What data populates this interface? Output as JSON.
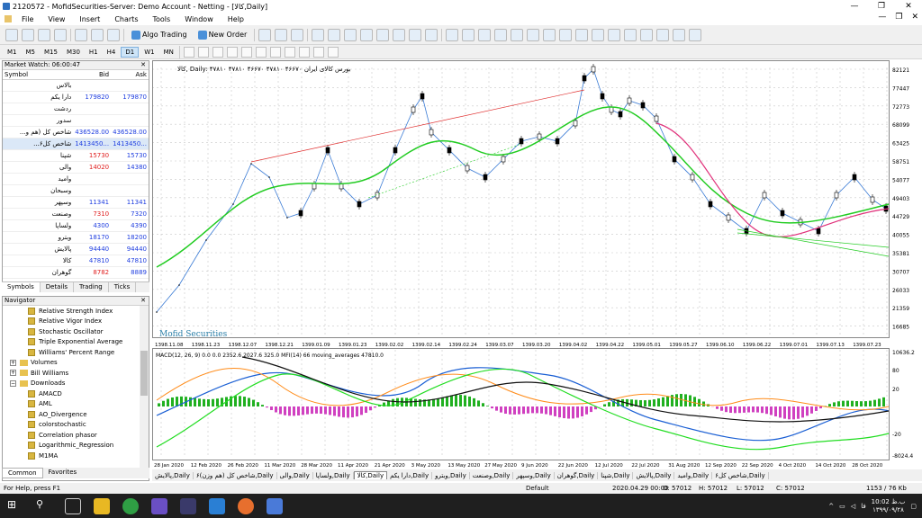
{
  "window": {
    "title": "2120572 - MofidSecurities-Server: Demo Account - Netting - [کالا,Daily]"
  },
  "menu": [
    "File",
    "View",
    "Insert",
    "Charts",
    "Tools",
    "Window",
    "Help"
  ],
  "toolbar": {
    "algo_label": "Algo Trading",
    "neworder_label": "New Order"
  },
  "timeframes": [
    "M1",
    "M5",
    "M15",
    "M30",
    "H1",
    "H4",
    "D1",
    "W1",
    "MN"
  ],
  "active_timeframe": "D1",
  "market_watch": {
    "title": "Market Watch: 06:00:47",
    "headers": {
      "symbol": "Symbol",
      "bid": "Bid",
      "ask": "Ask"
    },
    "rows": [
      {
        "symbol": "بالاس",
        "bid": "",
        "ask": ""
      },
      {
        "symbol": "دارا يکم",
        "bid": "179820",
        "ask": "179870"
      },
      {
        "symbol": "ردشت",
        "bid": "",
        "ask": ""
      },
      {
        "symbol": "سدور",
        "bid": "",
        "ask": ""
      },
      {
        "symbol": "شاخص کل (هم و...",
        "bid": "436528.00",
        "ask": "436528.00"
      },
      {
        "symbol": "شاخص کل۶...",
        "bid": "1413450...",
        "ask": "1413450..."
      },
      {
        "symbol": "شپنا",
        "bid": "15730",
        "ask": "15730"
      },
      {
        "symbol": "والی",
        "bid": "14020",
        "ask": "14380"
      },
      {
        "symbol": "واميد",
        "bid": "",
        "ask": ""
      },
      {
        "symbol": "وسبحان",
        "bid": "",
        "ask": ""
      },
      {
        "symbol": "وسپهر",
        "bid": "11341",
        "ask": "11341"
      },
      {
        "symbol": "وصنعت",
        "bid": "7310",
        "ask": "7320"
      },
      {
        "symbol": "ولساپا",
        "bid": "4300",
        "ask": "4390"
      },
      {
        "symbol": "وبترو",
        "bid": "18170",
        "ask": "18200"
      },
      {
        "symbol": "پالايش",
        "bid": "94440",
        "ask": "94440"
      },
      {
        "symbol": "کالا",
        "bid": "47810",
        "ask": "47810"
      },
      {
        "symbol": "گوهران",
        "bid": "8782",
        "ask": "8889"
      }
    ],
    "tabs": [
      "Symbols",
      "Details",
      "Trading",
      "Ticks"
    ]
  },
  "navigator": {
    "title": "Navigator",
    "items": [
      {
        "label": "Relative Strength Index",
        "type": "ind"
      },
      {
        "label": "Relative Vigor Index",
        "type": "ind"
      },
      {
        "label": "Stochastic Oscillator",
        "type": "ind"
      },
      {
        "label": "Triple Exponential Average",
        "type": "ind"
      },
      {
        "label": "Williams' Percent Range",
        "type": "ind"
      },
      {
        "label": "Volumes",
        "type": "folder"
      },
      {
        "label": "Bill Williams",
        "type": "folder"
      },
      {
        "label": "Downloads",
        "type": "open"
      },
      {
        "label": "AMACD",
        "type": "ind"
      },
      {
        "label": "AML",
        "type": "ind"
      },
      {
        "label": "AO_Divergence",
        "type": "ind"
      },
      {
        "label": "colorstochastic",
        "type": "ind"
      },
      {
        "label": "Correlation phasor",
        "type": "ind"
      },
      {
        "label": "Logarithmic_Regression",
        "type": "ind"
      },
      {
        "label": "M1MA",
        "type": "ind"
      }
    ],
    "tabs": [
      "Common",
      "Favorites"
    ]
  },
  "chart": {
    "header": "کالا, Daily: ۴۷۸۱۰ ۴۷۸۱۰ ۴۶۶۷۰ ۴۷۸۱۰ ۴۶۶۷۰  بورس کالای ایران",
    "watermark": "Mofid Securities",
    "price_ticks": [
      "82121",
      "77447",
      "72773",
      "68099",
      "63425",
      "58751",
      "54077",
      "49403",
      "44729",
      "40055",
      "35381",
      "30707",
      "26033",
      "21359",
      "16685"
    ],
    "jalali_dates": [
      "1398.11.08",
      "1398.11.23",
      "1398.12.07",
      "1398.12.21",
      "1399.01.09",
      "1399.01.23",
      "1399.02.02",
      "1399.02.14",
      "1399.02.24",
      "1399.03.07",
      "1399.03.20",
      "1399.04.02",
      "1399.04.22",
      "1399.05.01",
      "1399.05.27",
      "1399.06.10",
      "1399.06.22",
      "1399.07.01",
      "1399.07.13",
      "1399.07.23"
    ],
    "macd_label": "MACD(12, 26, 9) 0.0 0.0 2352.6 2027.6 325.0 MFI(14) 66 moving_averages 47810.0",
    "macd_ticks": [
      "10636.2",
      "80",
      "20",
      "-20",
      "-8024.4"
    ],
    "greg_dates": [
      "28 Jan 2020",
      "12 Feb 2020",
      "26 Feb 2020",
      "11 Mar 2020",
      "28 Mar 2020",
      "11 Apr 2020",
      "21 Apr 2020",
      "3 May 2020",
      "13 May 2020",
      "27 May 2020",
      "9 Jun 2020",
      "22 Jun 2020",
      "12 Jul 2020",
      "22 Jul 2020",
      "31 Aug 2020",
      "12 Sep 2020",
      "22 Sep 2020",
      "4 Oct 2020",
      "14 Oct 2020",
      "28 Oct 2020"
    ]
  },
  "chart_tabs": [
    "پالايش,Daily",
    "شاخص کل (هم وزن)۶,Daily",
    "والی,Daily",
    "ولساپا,Daily",
    "کالا,Daily",
    "دارا يکم,Daily",
    "وبترو,Daily",
    "وصنعت,Daily",
    "وسپهر,Daily",
    "گوهران,Daily",
    "شپنا,Daily",
    "پالايش,Daily",
    "واميد,Daily",
    "شاخص کل۶,Daily"
  ],
  "active_chart_tab": "کالا,Daily",
  "status": {
    "help": "For Help, press F1",
    "profile": "Default",
    "datetime": "2020.04.29 00:00",
    "open": "O: 57012",
    "high": "H: 57012",
    "low": "L: 57012",
    "close": "C: 57012",
    "traffic": "1153 / 76 Kb"
  },
  "taskbar": {
    "time": "10:02 ب.ظ",
    "date": "۱۳۹۹/۰۹/۲۸",
    "lang": "فا"
  }
}
